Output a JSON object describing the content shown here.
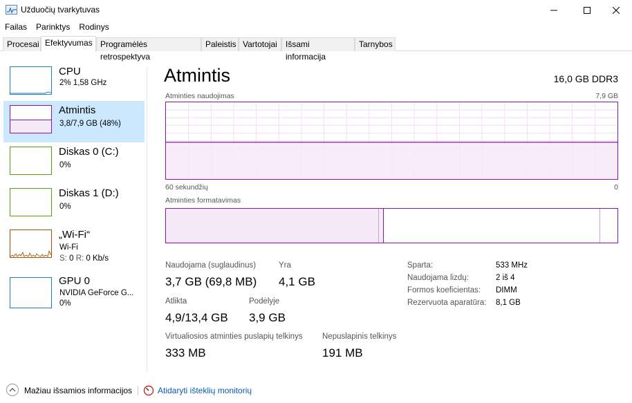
{
  "window": {
    "title": "Užduočių tvarkytuvas"
  },
  "menu": [
    "Failas",
    "Parinktys",
    "Rodinys"
  ],
  "tabs": [
    {
      "label": "Procesai"
    },
    {
      "label": "Efektyvumas"
    },
    {
      "label": "Programėlės retrospektyva"
    },
    {
      "label": "Paleistis"
    },
    {
      "label": "Vartotojai"
    },
    {
      "label": "Išsami informacija"
    },
    {
      "label": "Tarnybos"
    }
  ],
  "sidebar": {
    "cpu": {
      "title": "CPU",
      "sub": "2% 1,58 GHz",
      "color": "#1b80c4",
      "usage_percent": 2
    },
    "memory": {
      "title": "Atmintis",
      "sub": "3,8/7,9 GB (48%)",
      "color": "#8b12ae",
      "usage_percent": 48
    },
    "disk0": {
      "title": "Diskas 0 (C:)",
      "sub": "0%",
      "color": "#4da60c"
    },
    "disk1": {
      "title": "Diskas 1 (D:)",
      "sub": "0%",
      "color": "#4da60c"
    },
    "wifi": {
      "title": "„Wi-Fi“",
      "sub1": "Wi-Fi",
      "sub2_s_label": "S:",
      "sub2_s_val": "0",
      "sub2_r_label": "R:",
      "sub2_r_val": "0 Kb/s",
      "color": "#a74f01"
    },
    "gpu": {
      "title": "GPU 0",
      "sub1": "NVIDIA GeForce G...",
      "sub2": "0%",
      "color": "#1b80c4"
    }
  },
  "main": {
    "title": "Atmintis",
    "spec": "16,0 GB DDR3",
    "usage_label": "Atminties naudojimas",
    "usage_max": "7,9 GB",
    "time_label": "60 sekundžių",
    "time_min": "0",
    "composition_label": "Atminties formatavimas",
    "usage_fraction": 0.48,
    "accent": "#8b12ae",
    "fill": "#f4eaf7",
    "stats": {
      "in_use_label": "Naudojama (suglaudinus)",
      "in_use": "3,7 GB (69,8 MB)",
      "available_label": "Yra",
      "available": "4,1 GB",
      "committed_label": "Atlikta",
      "committed": "4,9/13,4 GB",
      "cached_label": "Podėlyje",
      "cached": "3,9 GB",
      "paged_label": "Virtualiosios atminties puslapių telkinys",
      "paged": "333 MB",
      "nonpaged_label": "Nepuslapinis telkinys",
      "nonpaged": "191 MB"
    },
    "details": [
      {
        "label": "Sparta:",
        "value": "533 MHz"
      },
      {
        "label": "Naudojama lizdų:",
        "value": "2 iš 4"
      },
      {
        "label": "Formos koeficientas:",
        "value": "DIMM"
      },
      {
        "label": "Rezervuota aparatūra:",
        "value": "8,1 GB"
      }
    ]
  },
  "footer": {
    "fewer_details": "Mažiau išsamios informacijos",
    "open_monitor": "Atidaryti išteklių monitorių"
  }
}
